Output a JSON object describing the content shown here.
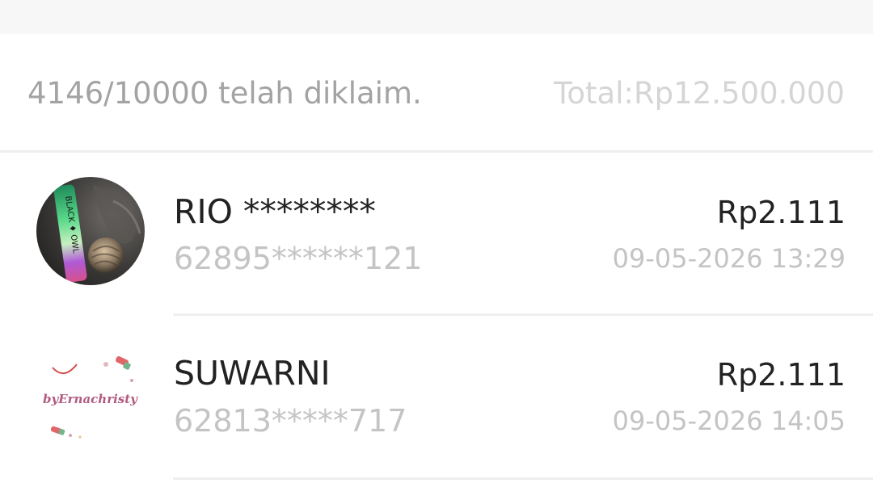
{
  "summary": {
    "claimed_text": "4146/10000 telah diklaim.",
    "total_text": "Total:Rp12.500.000"
  },
  "claims": [
    {
      "name": "RIO ********",
      "phone": "62895******121",
      "amount": "Rp2.111",
      "time": "09-05-2026 13:29",
      "avatar": "photo-avatar-black-owl-lanyard"
    },
    {
      "name": "SUWARNI",
      "phone": "62813*****717",
      "amount": "Rp2.111",
      "time": "09-05-2026 14:05",
      "avatar": "logo-avatar",
      "avatar_logo_text": "byErnachristy"
    }
  ]
}
